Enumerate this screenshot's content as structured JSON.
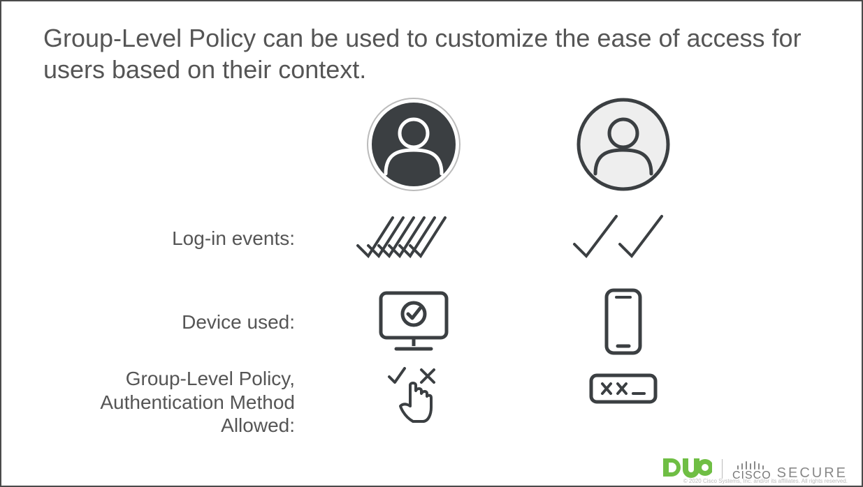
{
  "title": "Group-Level Policy can be used to customize the ease of access for users based on their context.",
  "rows": {
    "login": "Log-in events:",
    "device": "Device used:",
    "policy": "Group-Level Policy, Authentication Method Allowed:"
  },
  "footer": {
    "duo": "DUO",
    "cisco": "CISCO",
    "secure": "SECURE",
    "copyright": "© 2020 Cisco Systems, Inc. and/or its affiliates. All rights reserved."
  }
}
